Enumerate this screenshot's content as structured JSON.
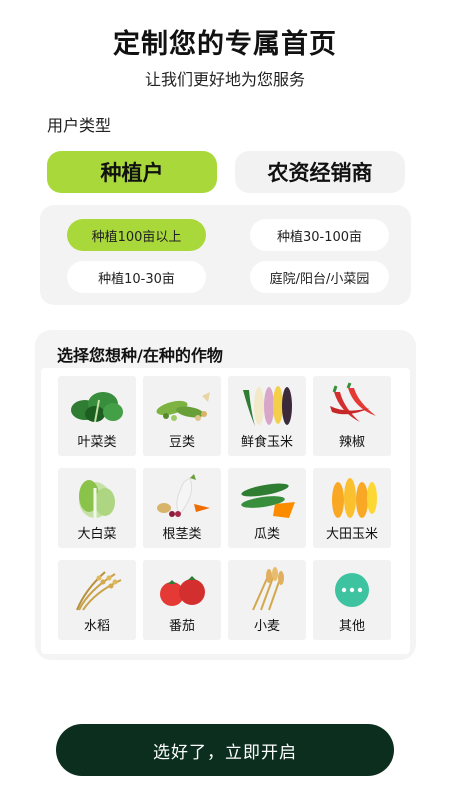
{
  "header": {
    "title": "定制您的专属首页",
    "subtitle": "让我们更好地为您服务"
  },
  "user_type": {
    "label": "用户类型",
    "options": [
      "种植户",
      "农资经销商"
    ],
    "selected": "种植户"
  },
  "scale": {
    "options": [
      "种植100亩以上",
      "种植30-100亩",
      "种植10-30亩",
      "庭院/阳台/小菜园"
    ],
    "selected": "种植100亩以上"
  },
  "crops": {
    "title": "选择您想种/在种的作物",
    "items": [
      {
        "label": "叶菜类",
        "icon": "leafy-greens-icon"
      },
      {
        "label": "豆类",
        "icon": "beans-icon"
      },
      {
        "label": "鲜食玉米",
        "icon": "fresh-corn-icon"
      },
      {
        "label": "辣椒",
        "icon": "chili-pepper-icon"
      },
      {
        "label": "大白菜",
        "icon": "napa-cabbage-icon"
      },
      {
        "label": "根茎类",
        "icon": "root-vegetables-icon"
      },
      {
        "label": "瓜类",
        "icon": "gourds-icon"
      },
      {
        "label": "大田玉米",
        "icon": "field-corn-icon"
      },
      {
        "label": "水稻",
        "icon": "rice-icon"
      },
      {
        "label": "番茄",
        "icon": "tomato-icon"
      },
      {
        "label": "小麦",
        "icon": "wheat-icon"
      },
      {
        "label": "其他",
        "icon": "more-icon"
      }
    ]
  },
  "footer": {
    "start_label": "选好了，立即开启"
  },
  "colors": {
    "accent": "#a9d83a",
    "button_dark": "#0b2e1f",
    "more_icon": "#3dc3a0"
  }
}
